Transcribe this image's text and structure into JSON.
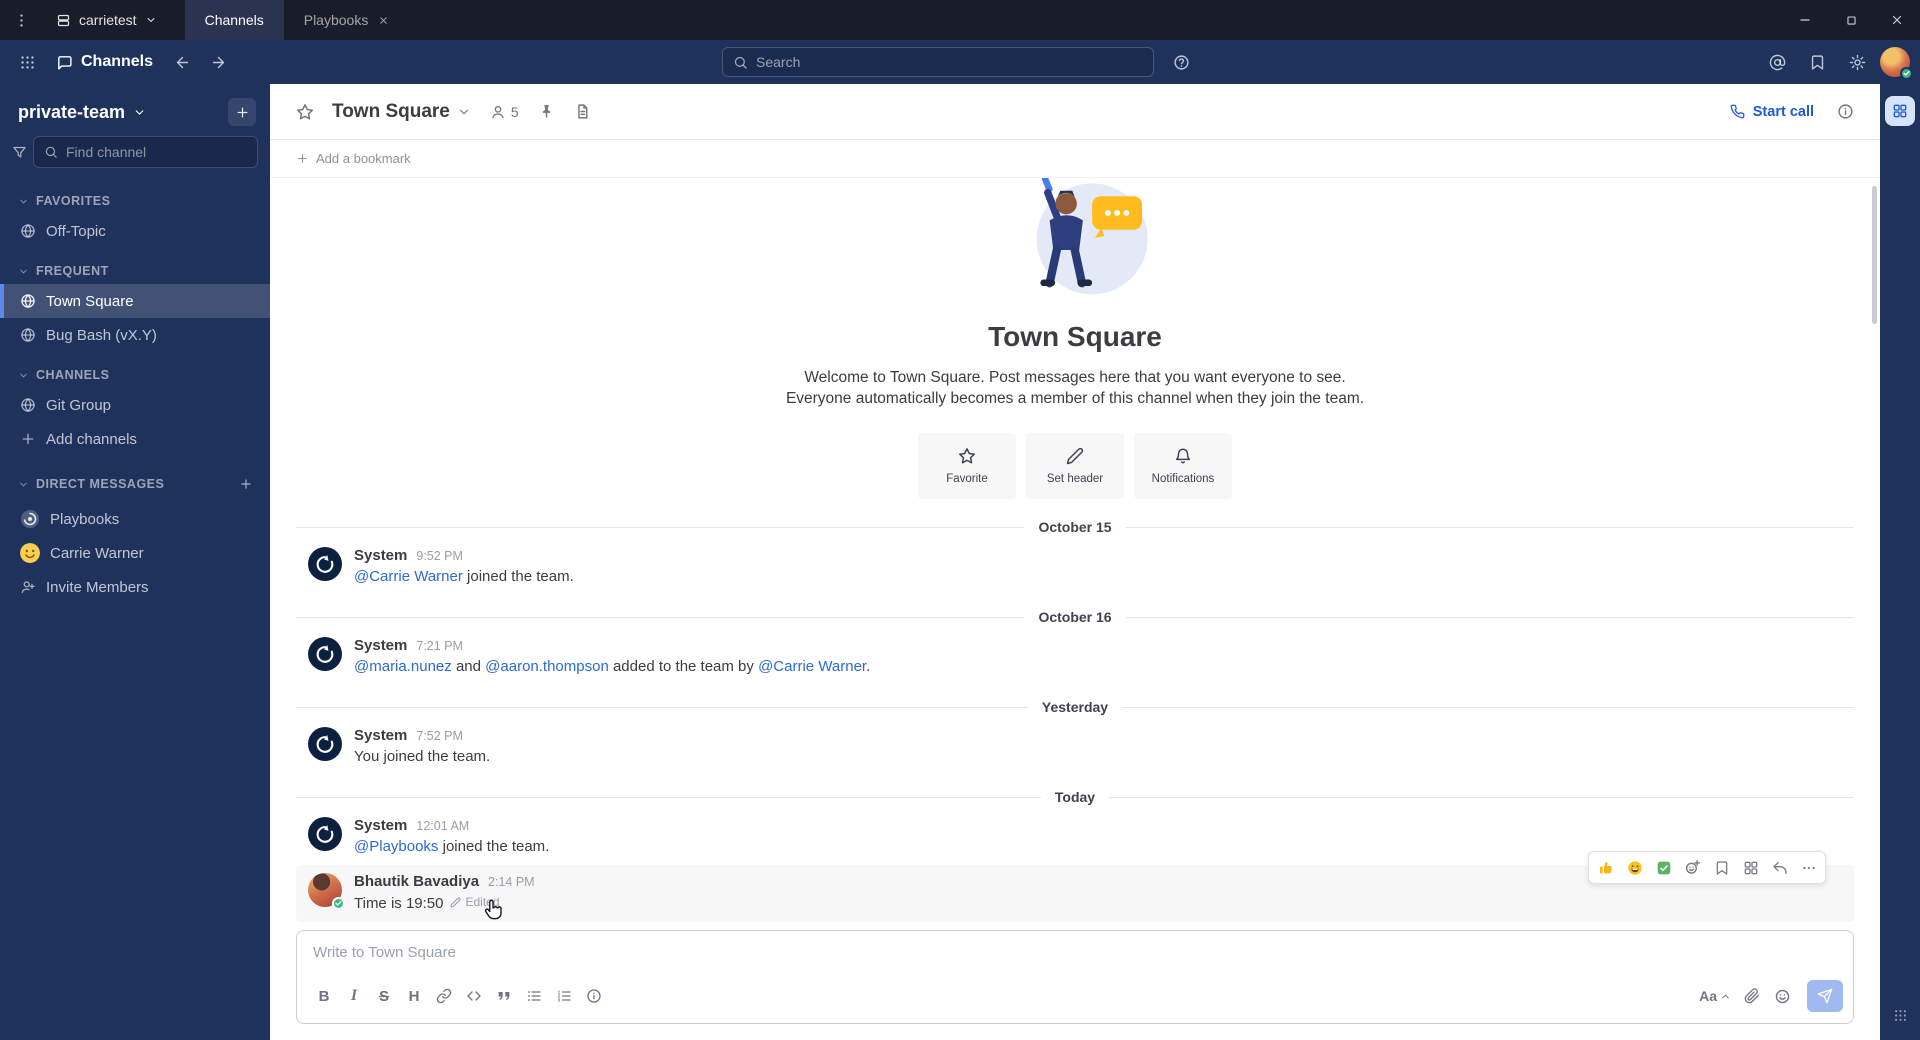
{
  "colors": {
    "titlebar_bg": "#191c2b",
    "tab_active_bg": "#2a3450",
    "header_bg": "#1e325c",
    "sidebar_bg": "#1e325c",
    "accent_blue": "#1c58d9",
    "link_blue": "#2d6ad2",
    "online_green": "#3db887",
    "text_primary": "#3d3c40"
  },
  "titlebar": {
    "team_name": "carrietest",
    "tabs": [
      {
        "label": "Channels"
      },
      {
        "label": "Playbooks"
      }
    ]
  },
  "global_header": {
    "product_name": "Channels",
    "search_placeholder": "Search"
  },
  "sidebar": {
    "team_name": "private-team",
    "find_channel_placeholder": "Find channel",
    "sections": {
      "favorites": {
        "label": "FAVORITES",
        "items": {
          "off_topic": "Off-Topic"
        }
      },
      "frequent": {
        "label": "FREQUENT",
        "items": {
          "town_square": "Town Square",
          "bug_bash": "Bug Bash (vX.Y)"
        }
      },
      "channels": {
        "label": "CHANNELS",
        "items": {
          "git_group": "Git Group",
          "add_channels": "Add channels"
        }
      },
      "direct_messages": {
        "label": "DIRECT MESSAGES",
        "items": {
          "playbooks": "Playbooks",
          "carrie_warner": "Carrie Warner",
          "invite_members": "Invite Members"
        }
      }
    }
  },
  "channel_header": {
    "title": "Town Square",
    "member_count": "5",
    "start_call_label": "Start call"
  },
  "bookmark_bar": {
    "add_label": "Add a bookmark"
  },
  "intro": {
    "title": "Town Square",
    "description": "Welcome to Town Square. Post messages here that you want everyone to see. Everyone automatically becomes a member of this channel when they join the team.",
    "actions": {
      "favorite": "Favorite",
      "set_header": "Set header",
      "notifications": "Notifications"
    }
  },
  "timeline": {
    "divider1": "October 15",
    "divider2": "October 16",
    "divider3": "Yesterday",
    "divider4": "Today",
    "msg1": {
      "author": "System",
      "time": "9:52 PM",
      "link1": "@Carrie Warner",
      "text1": " joined the team."
    },
    "msg2": {
      "author": "System",
      "time": "7:21 PM",
      "link1": "@maria.nunez",
      "text1": " and ",
      "link2": "@aaron.thompson",
      "text2": " added to the team by ",
      "link3": "@Carrie Warner",
      "text3": "."
    },
    "msg3": {
      "author": "System",
      "time": "7:52 PM",
      "text1": "You joined the team."
    },
    "msg4": {
      "author": "System",
      "time": "12:01 AM",
      "link1": "@Playbooks",
      "text1": " joined the team."
    },
    "msg5": {
      "author": "Bhautik Bavadiya",
      "time": "2:14 PM",
      "text1": "Time is 19:50",
      "edited_label": "Edited"
    }
  },
  "composer": {
    "placeholder": "Write to Town Square",
    "formatting_label": "Aa",
    "bold_label": "B",
    "italic_label": "I",
    "strike_label": "S",
    "heading_label": "H"
  }
}
